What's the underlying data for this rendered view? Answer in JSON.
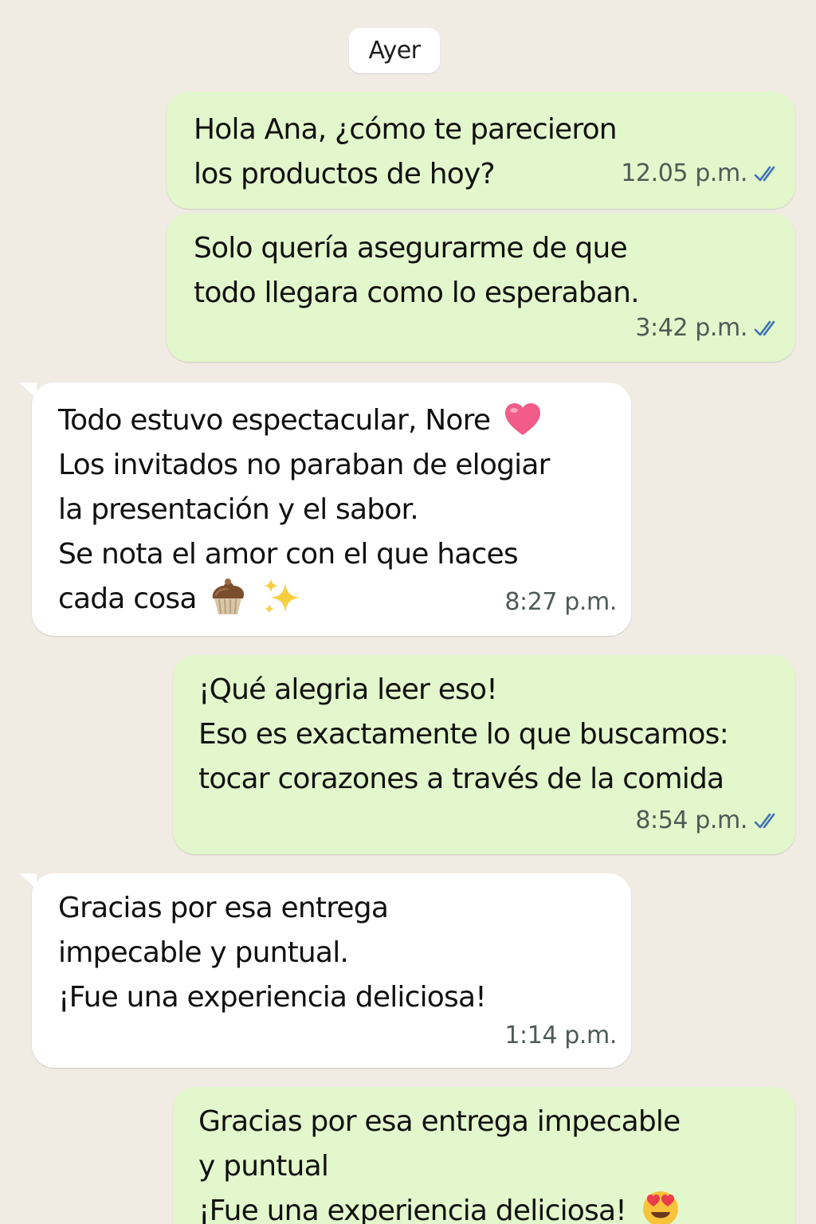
{
  "chat": {
    "day_label": "Ayer",
    "colors": {
      "background": "#f0ebe3",
      "outgoing_bubble": "#e2f7cb",
      "incoming_bubble": "#ffffff",
      "read_ticks": "#3b6fb6",
      "heart_emoji": "#f25c8a"
    },
    "messages": [
      {
        "direction": "outgoing",
        "lines": [
          "Hola Ana, ¿cómo te parecieron",
          "los productos de hoy?"
        ],
        "time": "12.05 p.m.",
        "status": "read-double-check-icon"
      },
      {
        "direction": "outgoing",
        "lines": [
          "Solo quería asegurarme de que",
          "todo llegara como lo esperaban."
        ],
        "time": "3:42 p.m.",
        "status": "read-double-check-icon"
      },
      {
        "direction": "incoming",
        "lines": [
          "Todo estuvo espectacular, Nore",
          "Los invitados no paraban de elogiar",
          "la presentación y el sabor.",
          "Se nota el amor con el que haces",
          "cada cosa"
        ],
        "emojis": [
          "heart-emoji",
          "cupcake-emoji",
          "sparkles-emoji"
        ],
        "time": "8:27 p.m."
      },
      {
        "direction": "outgoing",
        "lines": [
          "¡Qué alegria leer eso!",
          "Eso es exactamente lo que buscamos:",
          "tocar corazones a través de la comida"
        ],
        "time": "8:54 p.m.",
        "status": "read-double-check-icon"
      },
      {
        "direction": "incoming",
        "lines": [
          "Gracias por esa entrega",
          "impecable y puntual.",
          "¡Fue una experiencia deliciosa!"
        ],
        "time": "1:14 p.m."
      },
      {
        "direction": "outgoing",
        "lines": [
          "Gracias por esa entrega impecable",
          "y puntual",
          "¡Fue una experiencia deliciosa!"
        ],
        "emojis": [
          "heart-eyes-emoji"
        ]
      }
    ]
  }
}
